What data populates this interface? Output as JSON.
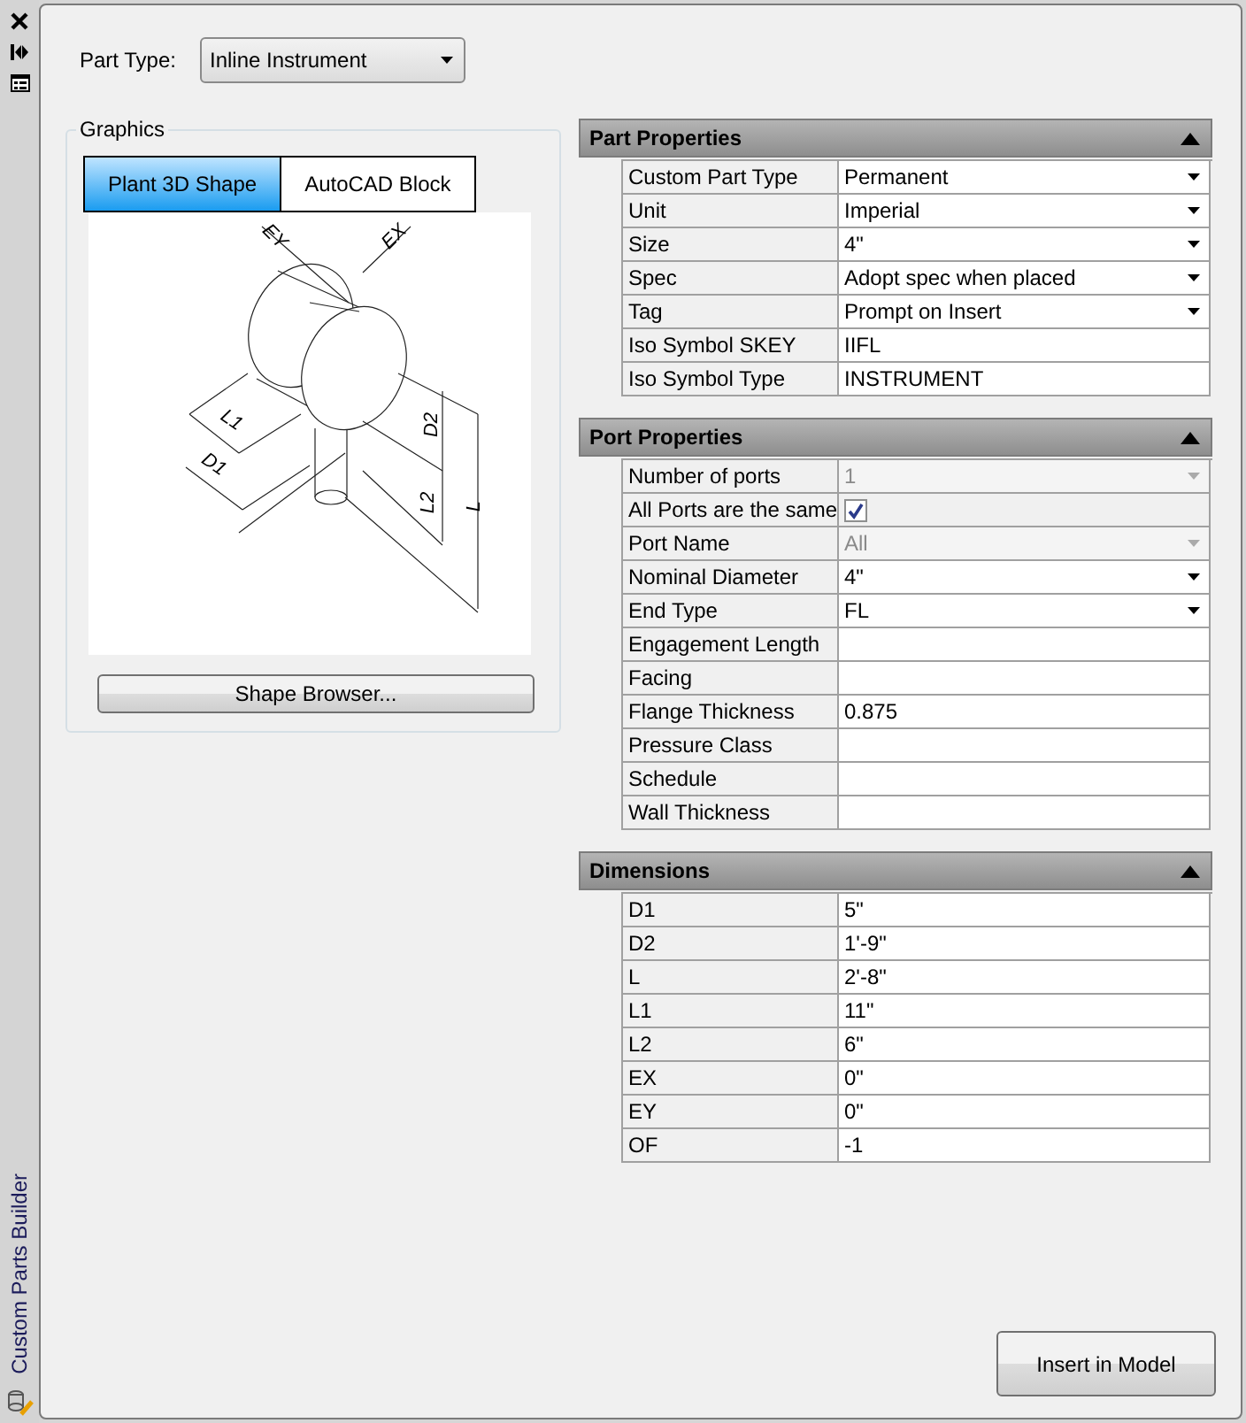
{
  "sidebar": {
    "title": "Custom Parts Builder"
  },
  "part_type": {
    "label": "Part Type:",
    "value": "Inline Instrument"
  },
  "graphics": {
    "title": "Graphics",
    "tabs": [
      {
        "label": "Plant 3D Shape",
        "selected": true
      },
      {
        "label": "AutoCAD Block",
        "selected": false
      }
    ],
    "drawing_labels": [
      "EY",
      "EX",
      "L1",
      "D1",
      "D2",
      "L2",
      "L"
    ],
    "button": "Shape Browser..."
  },
  "sections": [
    {
      "title": "Part Properties",
      "expanded": true,
      "rows": [
        {
          "label": "Custom Part Type",
          "kind": "dropdown",
          "value": "Permanent",
          "disabled": false
        },
        {
          "label": "Unit",
          "kind": "dropdown",
          "value": "Imperial",
          "disabled": false
        },
        {
          "label": "Size",
          "kind": "dropdown",
          "value": "4\"",
          "disabled": false
        },
        {
          "label": "Spec",
          "kind": "dropdown",
          "value": "Adopt spec when placed",
          "disabled": false
        },
        {
          "label": "Tag",
          "kind": "dropdown",
          "value": "Prompt on Insert",
          "disabled": false
        },
        {
          "label": "Iso Symbol SKEY",
          "kind": "text",
          "value": "IIFL",
          "disabled": false
        },
        {
          "label": "Iso Symbol Type",
          "kind": "text",
          "value": "INSTRUMENT",
          "disabled": false
        }
      ]
    },
    {
      "title": "Port Properties",
      "expanded": true,
      "rows": [
        {
          "label": "Number of ports",
          "kind": "dropdown",
          "value": "1",
          "disabled": true
        },
        {
          "label": "All Ports are the same",
          "kind": "checkbox",
          "checked": true
        },
        {
          "label": "Port Name",
          "kind": "dropdown",
          "value": "All",
          "disabled": true
        },
        {
          "label": "Nominal Diameter",
          "kind": "dropdown",
          "value": "4\"",
          "disabled": false
        },
        {
          "label": "End Type",
          "kind": "dropdown",
          "value": "FL",
          "disabled": false
        },
        {
          "label": "Engagement Length",
          "kind": "text",
          "disabled": false
        },
        {
          "label": "Facing",
          "kind": "text",
          "disabled": false
        },
        {
          "label": "Flange Thickness",
          "kind": "text",
          "value": "0.875",
          "disabled": false
        },
        {
          "label": "Pressure Class",
          "kind": "text",
          "disabled": false
        },
        {
          "label": "Schedule",
          "kind": "text",
          "disabled": false
        },
        {
          "label": "Wall Thickness",
          "kind": "text",
          "disabled": false
        }
      ]
    },
    {
      "title": "Dimensions",
      "expanded": true,
      "rows": [
        {
          "label": "D1",
          "kind": "text",
          "value": "5\"",
          "disabled": false
        },
        {
          "label": "D2",
          "kind": "text",
          "value": "1'-9\"",
          "disabled": false
        },
        {
          "label": "L",
          "kind": "text",
          "value": "2'-8\"",
          "disabled": false
        },
        {
          "label": "L1",
          "kind": "text",
          "value": "11\"",
          "disabled": false
        },
        {
          "label": "L2",
          "kind": "text",
          "value": "6\"",
          "disabled": false
        },
        {
          "label": "EX",
          "kind": "text",
          "value": "0\"",
          "disabled": false
        },
        {
          "label": "EY",
          "kind": "text",
          "value": "0\"",
          "disabled": false
        },
        {
          "label": "OF",
          "kind": "text",
          "value": "-1",
          "disabled": false
        }
      ]
    }
  ],
  "insert_button": "Insert in Model"
}
